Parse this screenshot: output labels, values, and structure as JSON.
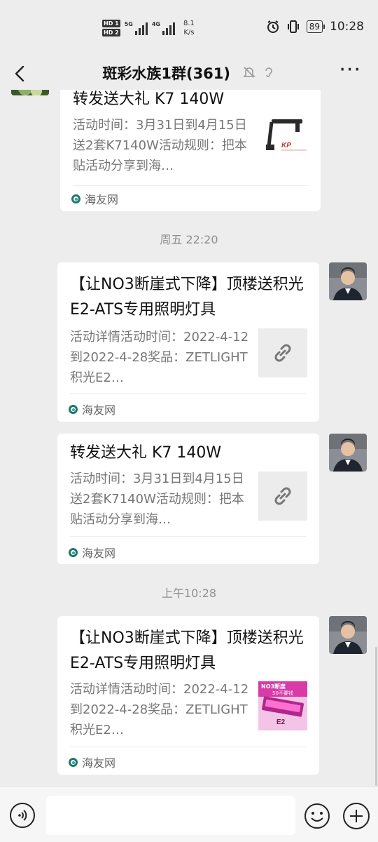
{
  "status_bar": {
    "net1": "5G",
    "net2": "4G",
    "speed_value": "8.1",
    "speed_unit": "K/s",
    "battery": "89",
    "time": "10:28"
  },
  "header": {
    "title": "斑彩水族1群(361)"
  },
  "messages": [
    {
      "title": "转发送大礼 K7 140W",
      "desc": "活动时间：3月31日到4月15日送2套K7140W活动规则：把本贴活动分享到海…",
      "source": "海友网"
    },
    {
      "title": "【让NO3断崖式下降】顶楼送积光E2-ATS专用照明灯具",
      "desc": "活动详情活动时间：2022-4-12到2022-4-28奖品：ZETLIGHT积光E2…",
      "source": "海友网"
    },
    {
      "title": "转发送大礼 K7 140W",
      "desc": "活动时间：3月31日到4月15日送2套K7140W活动规则：把本贴活动分享到海…",
      "source": "海友网"
    },
    {
      "title": "【让NO3断崖式下降】顶楼送积光E2-ATS专用照明灯具",
      "desc": "活动详情活动时间：2022-4-12到2022-4-28奖品：ZETLIGHT积光E2…",
      "source": "海友网"
    }
  ],
  "timestamps": {
    "t1": "周五 22:20",
    "t2": "上午10:28"
  },
  "thumb_texts": {
    "lamp_brand": "KP",
    "promo_line1": "NO3断崖",
    "promo_line2": "50不要钱",
    "promo_model": "E2"
  },
  "colors": {
    "background": "#ededed",
    "card": "#ffffff",
    "source_icon": "#1f7a5a"
  }
}
